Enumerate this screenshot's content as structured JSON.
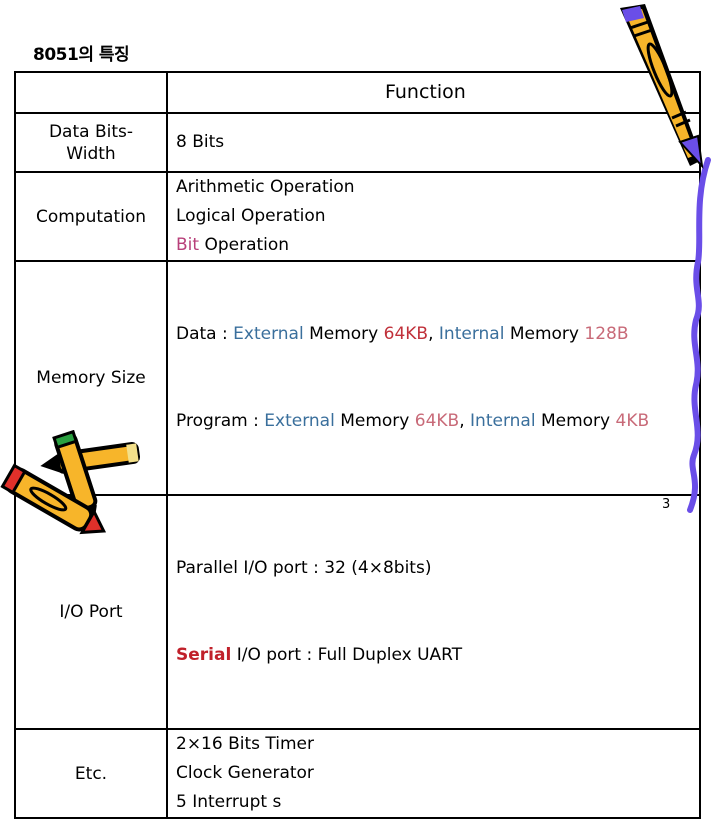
{
  "slide": {
    "title": "8051의 특징",
    "page_number": "3"
  },
  "table": {
    "header": {
      "label": "",
      "function": "Function"
    },
    "rows": [
      {
        "label": "Data Bits-\nWidth",
        "label_line1": "Data Bits-",
        "label_line2": "Width",
        "lines": [
          "8 Bits"
        ]
      },
      {
        "label": "Computation",
        "lines": [
          "Arithmetic Operation",
          "Logical Operation",
          "Bit Operation"
        ],
        "bit_word": "Bit",
        "bit_rest": " Operation"
      },
      {
        "label": "Memory Size",
        "data": {
          "prefix": "Data : ",
          "ext": "External",
          "mem1": " Memory ",
          "size1": "64KB",
          "sep": ", ",
          "int": "Internal",
          "mem2": " Memory ",
          "size2": "128B"
        },
        "program": {
          "prefix": "Program : ",
          "ext": "External",
          "mem1": " Memory ",
          "size1": "64KB",
          "sep": ", ",
          "int": "Internal",
          "mem2": " Memory ",
          "size2": "4KB"
        }
      },
      {
        "label": "I/O Port",
        "parallel": "Parallel I/O port : 32 (4×8bits)",
        "serial_word": "Serial",
        "serial_rest": " I/O port : Full Duplex UART"
      },
      {
        "label": "Etc.",
        "lines": [
          "2×16 Bits Timer",
          "Clock Generator",
          "5 Interrupt s"
        ]
      }
    ]
  },
  "colors": {
    "blue_text": "#3a6f9c",
    "red_text": "#c0303a",
    "pink_text": "#c86a78",
    "magenta_text": "#b8407a",
    "pencil_yellow": "#f7b52a",
    "pencil_purple": "#6a4ee8",
    "crayon_red": "#e0302a",
    "crayon_green": "#2aa040"
  }
}
